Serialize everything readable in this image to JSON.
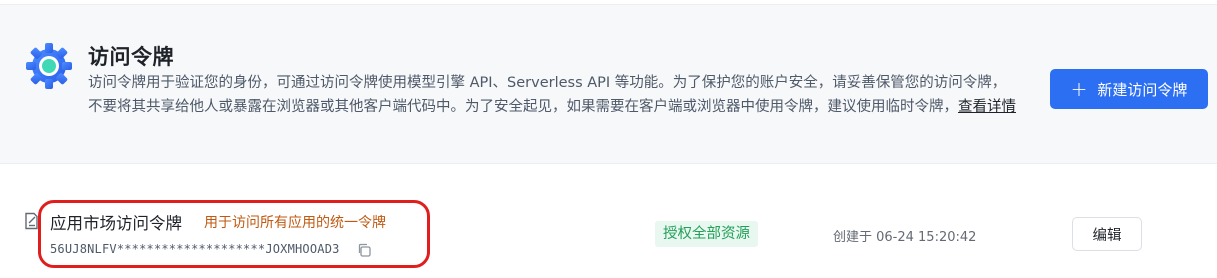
{
  "banner": {
    "title": "访问令牌",
    "description": "访问令牌用于验证您的身份，可通过访问令牌使用模型引擎 API、Serverless API 等功能。为了保护您的账户安全，请妥善保管您的访问令牌，不要将其共享给他人或暴露在浏览器或其他客户端代码中。为了安全起见，如果需要在客户端或浏览器中使用令牌，建议使用临时令牌，",
    "details_link": "查看详情",
    "new_token_button": "新建访问令牌",
    "icon": "gear-icon",
    "accent_color": "#2c6ff3"
  },
  "token": {
    "name": "应用市场访问令牌",
    "description": "用于访问所有应用的统一令牌",
    "key": "56UJ8NLFV********************JOXMHOOAD3",
    "scope_badge": "授权全部资源",
    "created": "创建于 06-24 15:20:42",
    "edit_button": "编辑",
    "icons": [
      "doc-icon",
      "copy-icon"
    ],
    "highlight_color": "#e01e1e"
  }
}
